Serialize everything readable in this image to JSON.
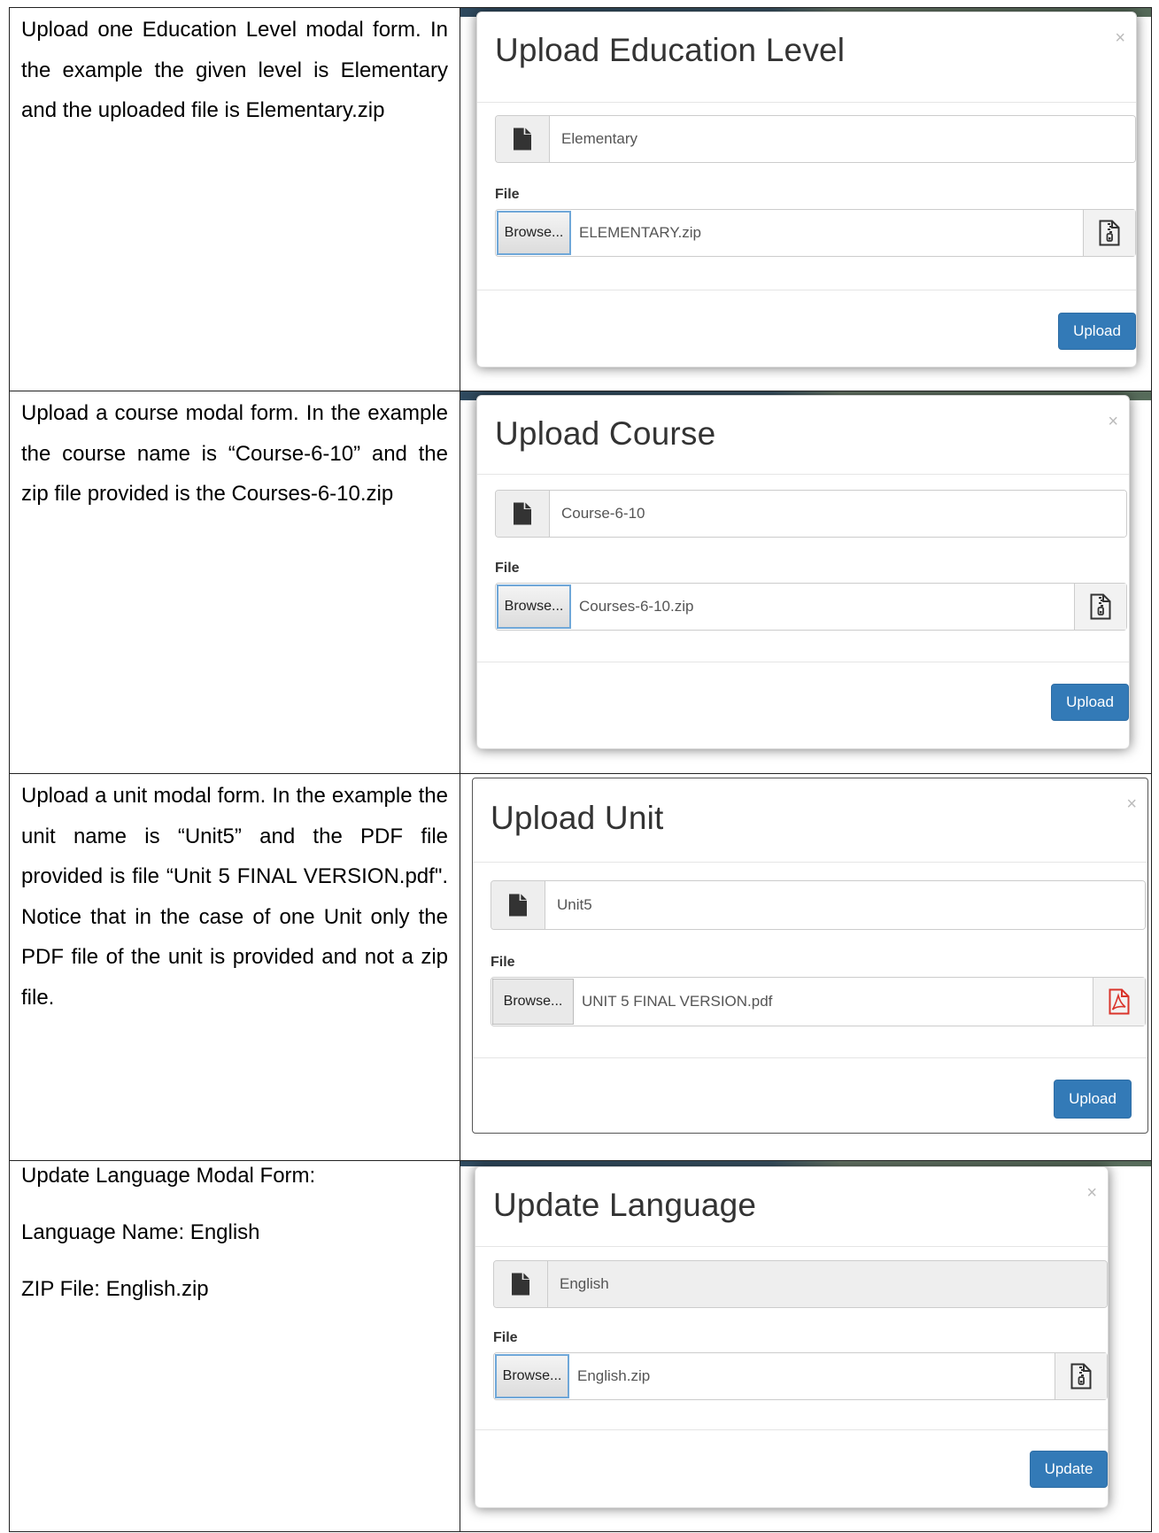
{
  "rows": [
    {
      "description": "Upload one Education Level modal form. In the example the given level is Elementary and the uploaded file is Elementary.zip",
      "modal": {
        "title": "Upload Education Level",
        "close_glyph": "×",
        "name_value": "Elementary",
        "file_label": "File",
        "browse_label": "Browse...",
        "file_name": "ELEMENTARY.zip",
        "file_icon": "zip-file-icon",
        "action_label": "Upload"
      }
    },
    {
      "description": "Upload a course modal form. In the example the course name is “Course-6-10” and the zip file provided is the Courses-6-10.zip",
      "modal": {
        "title": "Upload Course",
        "close_glyph": "×",
        "name_value": "Course-6-10",
        "file_label": "File",
        "browse_label": "Browse...",
        "file_name": "Courses-6-10.zip",
        "file_icon": "zip-file-icon",
        "action_label": "Upload"
      }
    },
    {
      "description": "Upload a unit modal form. In the example the unit name is “Unit5” and the PDF file provided is file “Unit 5 FINAL VERSION.pdf\". Notice that in the case of one Unit only the PDF file of the unit is provided and not a zip file.",
      "modal": {
        "title": "Upload Unit",
        "close_glyph": "×",
        "name_value": "Unit5",
        "file_label": "File",
        "browse_label": "Browse...",
        "file_name": "UNIT 5 FINAL VERSION.pdf",
        "file_icon": "pdf-file-icon",
        "action_label": "Upload"
      }
    },
    {
      "description_lines": [
        "Update Language Modal Form:",
        "Language Name: English",
        "ZIP File: English.zip"
      ],
      "modal": {
        "title": "Update Language",
        "close_glyph": "×",
        "name_value": "English",
        "file_label": "File",
        "browse_label": "Browse...",
        "file_name": "English.zip",
        "file_icon": "zip-file-icon",
        "action_label": "Update"
      }
    }
  ],
  "colors": {
    "primary_button": "#337ab7",
    "pdf_icon": "#d9342b",
    "focus_border": "#6fa7d8"
  }
}
